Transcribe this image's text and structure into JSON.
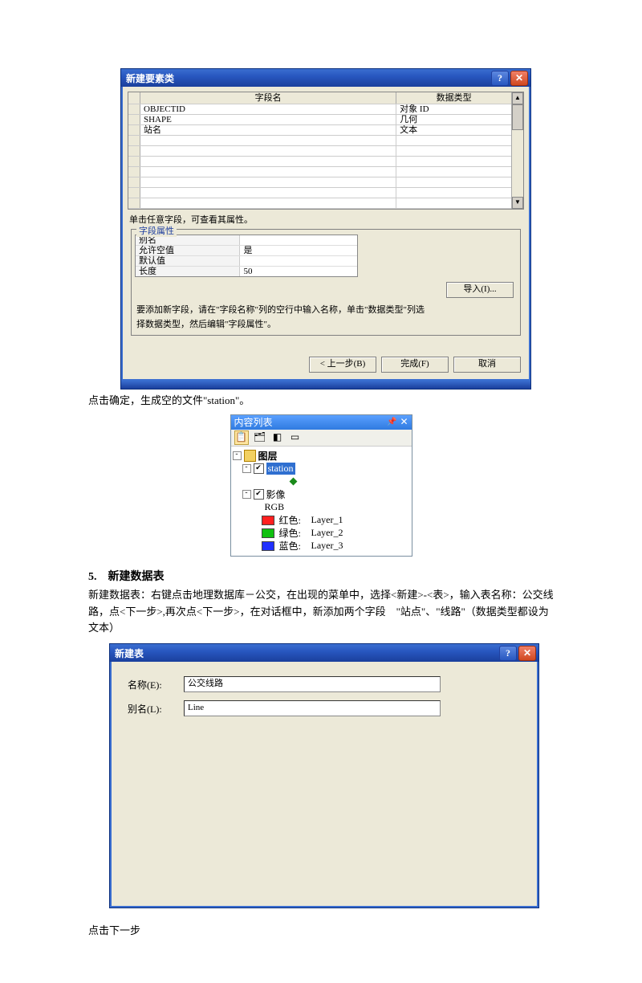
{
  "dialog1": {
    "title": "新建要素类",
    "help_icon": "?",
    "close_icon": "✕",
    "columns": {
      "col1": "字段名",
      "col2": "数据类型"
    },
    "rows": [
      {
        "name": "OBJECTID",
        "type": "对象 ID"
      },
      {
        "name": "SHAPE",
        "type": "几何"
      },
      {
        "name": "站名",
        "type": "文本"
      }
    ],
    "row_click_hint": "单击任意字段，可查看其属性。",
    "group_legend": "字段属性",
    "props": [
      {
        "k": "别名",
        "v": ""
      },
      {
        "k": "允许空值",
        "v": "是"
      },
      {
        "k": "默认值",
        "v": ""
      },
      {
        "k": "长度",
        "v": "50"
      }
    ],
    "import_btn": "导入(I)...",
    "instr_line1": "要添加新字段，请在\"字段名称\"列的空行中输入名称，单击\"数据类型\"列选",
    "instr_line2": "择数据类型，然后编辑\"字段属性\"。",
    "buttons": {
      "back": "< 上一步(B)",
      "finish": "完成(F)",
      "cancel": "取消"
    }
  },
  "prose1": "点击确定，生成空的文件\"station\"。",
  "toc": {
    "title": "内容列表",
    "pin": "📌",
    "close": "✕",
    "tree": {
      "layers_label": "图层",
      "station_label": "station",
      "image_label": "影像",
      "rgb_label": "RGB",
      "bands": [
        {
          "color": "#ff2020",
          "name": "红色:",
          "layer": "Layer_1"
        },
        {
          "color": "#10c010",
          "name": "绿色:",
          "layer": "Layer_2"
        },
        {
          "color": "#2030ff",
          "name": "蓝色:",
          "layer": "Layer_3"
        }
      ]
    }
  },
  "section5_title": "5.　新建数据表",
  "section5_body": "新建数据表：右键点击地理数据库－公交，在出现的菜单中，选择<新建>-<表>，输入表名称：公交线路，点<下一步>,再次点<下一步>，在对话框中，新添加两个字段　\"站点\"、\"线路\"（数据类型都设为文本）",
  "dialog2": {
    "title": "新建表",
    "help_icon": "?",
    "close_icon": "✕",
    "name_label": "名称(E):",
    "name_value": "公交线路",
    "alias_label": "别名(L):",
    "alias_value": "Line"
  },
  "prose2": "点击下一步"
}
